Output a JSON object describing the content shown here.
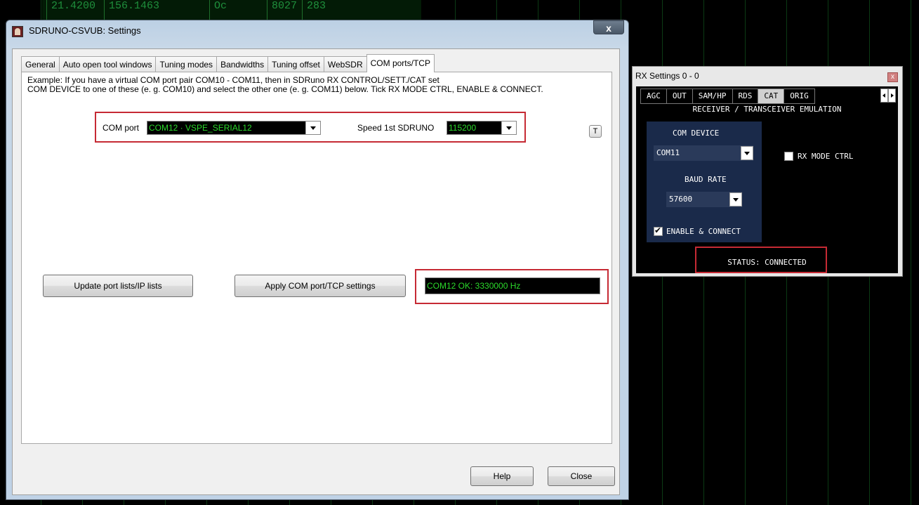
{
  "background": {
    "strip_values": [
      "21.4200",
      "156.1463",
      "Oc",
      "8027",
      "283"
    ]
  },
  "settings_window": {
    "title": "SDRUNO-CSVUB: Settings",
    "close_symbol": "x",
    "tabs": [
      {
        "label": "General",
        "active": false
      },
      {
        "label": "Auto open tool windows",
        "active": false
      },
      {
        "label": "Tuning modes",
        "active": false
      },
      {
        "label": "Bandwidths",
        "active": false
      },
      {
        "label": "Tuning offset",
        "active": false
      },
      {
        "label": "WebSDR",
        "active": false
      },
      {
        "label": "COM ports/TCP",
        "active": true
      }
    ],
    "instructions": {
      "line1": "Example: If you have a virtual COM port pair COM10 - COM11, then in SDRuno RX CONTROL/SETT./CAT set",
      "line2": "COM DEVICE to one of these (e. g. COM10) and select the other one (e. g. COM11) below. Tick RX MODE CTRL, ENABLE & CONNECT."
    },
    "com_port": {
      "label": "COM port",
      "value": "COM12 · VSPE_SERIAL12"
    },
    "speed": {
      "label": "Speed 1st SDRUNO",
      "value": "115200"
    },
    "t_button": "T",
    "update_button": "Update port lists/IP lists",
    "apply_button": "Apply COM port/TCP settings",
    "status_text": "COM12 OK: 3330000 Hz",
    "help_button": "Help",
    "close_button": "Close"
  },
  "rx_window": {
    "title": "RX Settings 0 - 0",
    "close_symbol": "x",
    "tabs": [
      {
        "label": "AGC",
        "active": false
      },
      {
        "label": "OUT",
        "active": false
      },
      {
        "label": "SAM/HP",
        "active": false
      },
      {
        "label": "RDS",
        "active": false
      },
      {
        "label": "CAT",
        "active": true
      },
      {
        "label": "ORIG",
        "active": false
      }
    ],
    "heading": "RECEIVER / TRANSCEIVER EMULATION",
    "com_device_label": "COM DEVICE",
    "com_device_value": "COM11",
    "baud_rate_label": "BAUD RATE",
    "baud_rate_value": "57600",
    "enable_connect_label": "ENABLE & CONNECT",
    "enable_connect_checked": true,
    "rx_mode_ctrl_label": "RX MODE CTRL",
    "rx_mode_ctrl_checked": false,
    "status": "STATUS: CONNECTED"
  },
  "colors": {
    "highlight_red": "#c62a34",
    "field_green": "#2bd92b"
  }
}
